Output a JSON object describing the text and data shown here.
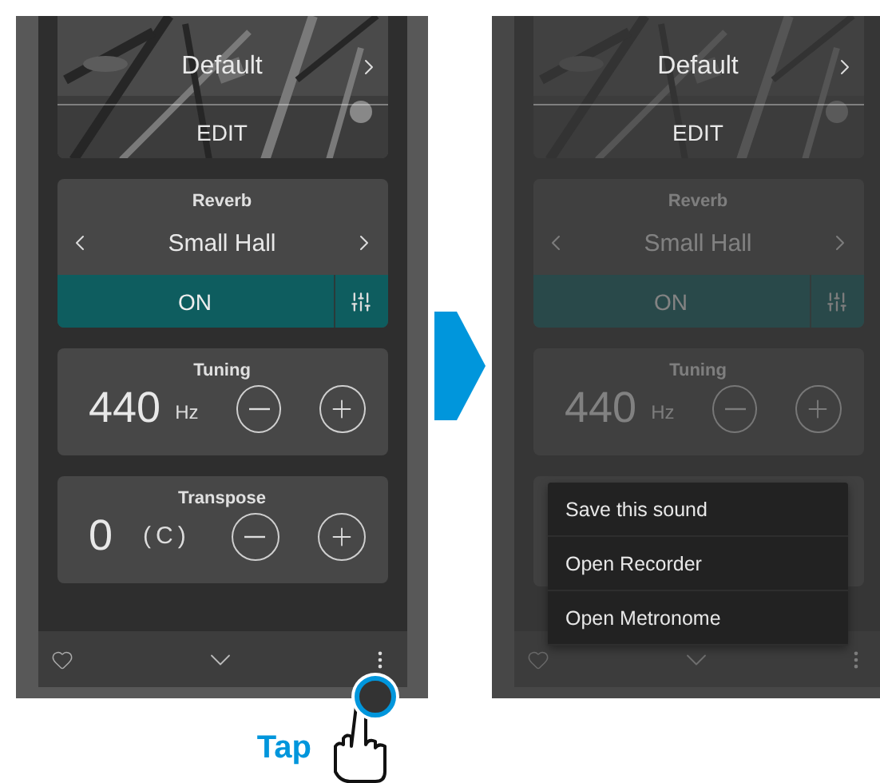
{
  "screens": [
    {
      "dimmed": false,
      "preset": {
        "value": "Default",
        "action": "EDIT"
      },
      "reverb": {
        "title": "Reverb",
        "value": "Small Hall",
        "on": true,
        "label": "ON"
      },
      "tuning": {
        "title": "Tuning",
        "value": "440",
        "unit": "Hz"
      },
      "transpose": {
        "title": "Transpose",
        "value": "0",
        "unit": "(C)"
      }
    },
    {
      "dimmed": true,
      "preset": {
        "value": "Default",
        "action": "EDIT"
      },
      "reverb": {
        "title": "Reverb",
        "value": "Small Hall",
        "on": true,
        "label": "ON"
      },
      "tuning": {
        "title": "Tuning",
        "value": "440",
        "unit": "Hz"
      },
      "menu": [
        {
          "label": "Save this sound"
        },
        {
          "label": "Open Recorder"
        },
        {
          "label": "Open Metronome"
        }
      ]
    }
  ],
  "tap_hint": {
    "label": "Tap"
  }
}
